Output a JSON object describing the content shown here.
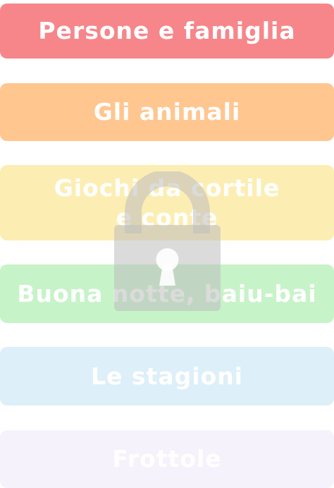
{
  "categories": [
    {
      "label": "Persone e famiglia",
      "locked": false
    },
    {
      "label": "Gli animali",
      "locked": false
    },
    {
      "label": "Giochi da cortile\ne conte",
      "locked": true
    },
    {
      "label": "Buona notte, baiu-bai",
      "locked": true
    },
    {
      "label": "Le stagioni",
      "locked": true
    },
    {
      "label": "Frottole",
      "locked": true
    }
  ],
  "overlay": {
    "icon": "lock-icon"
  },
  "colors": {
    "persone": "#F6868A",
    "animali": "#FFC68F",
    "giochi": "#FCEEB3",
    "buona_notte": "#C6F3C8",
    "stagioni": "#DDEFF8",
    "frottole": "#F5F2FB",
    "lock": "#BDBDBD"
  }
}
